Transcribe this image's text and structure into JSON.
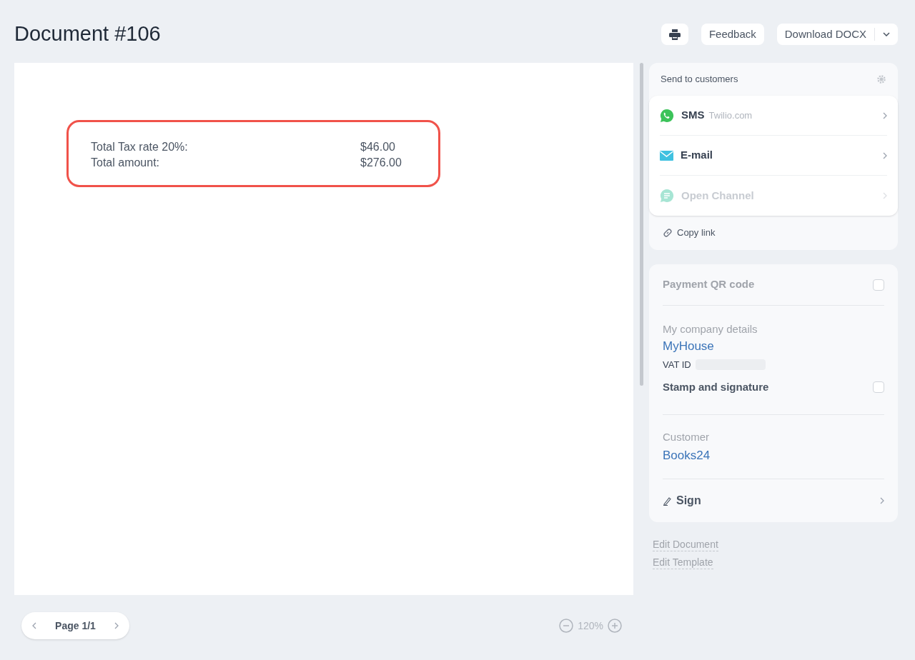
{
  "title": "Document #106",
  "toolbar": {
    "feedback": "Feedback",
    "download": "Download DOCX"
  },
  "document": {
    "totals": [
      {
        "label": "Total Tax rate 20%:",
        "value": "$46.00"
      },
      {
        "label": "Total amount:",
        "value": "$276.00"
      }
    ]
  },
  "pager": {
    "label": "Page 1/1"
  },
  "zoom": {
    "label": "120%"
  },
  "send": {
    "title": "Send to customers",
    "channels": [
      {
        "kind": "sms",
        "label": "SMS",
        "sub": "Twilio.com",
        "disabled": false
      },
      {
        "kind": "email",
        "label": "E-mail",
        "disabled": false
      },
      {
        "kind": "open",
        "label": "Open Channel",
        "disabled": true
      }
    ],
    "copy_link": "Copy link"
  },
  "settings": {
    "payment_qr": {
      "label": "Payment QR code",
      "checked": false,
      "disabled": true
    },
    "company": {
      "heading": "My company details",
      "name": "MyHouse",
      "vat_label": "VAT ID"
    },
    "stamp": {
      "label": "Stamp and signature",
      "checked": false,
      "disabled": false
    },
    "customer": {
      "heading": "Customer",
      "name": "Books24"
    },
    "sign": "Sign"
  },
  "links": [
    "Edit Document",
    "Edit Template"
  ]
}
